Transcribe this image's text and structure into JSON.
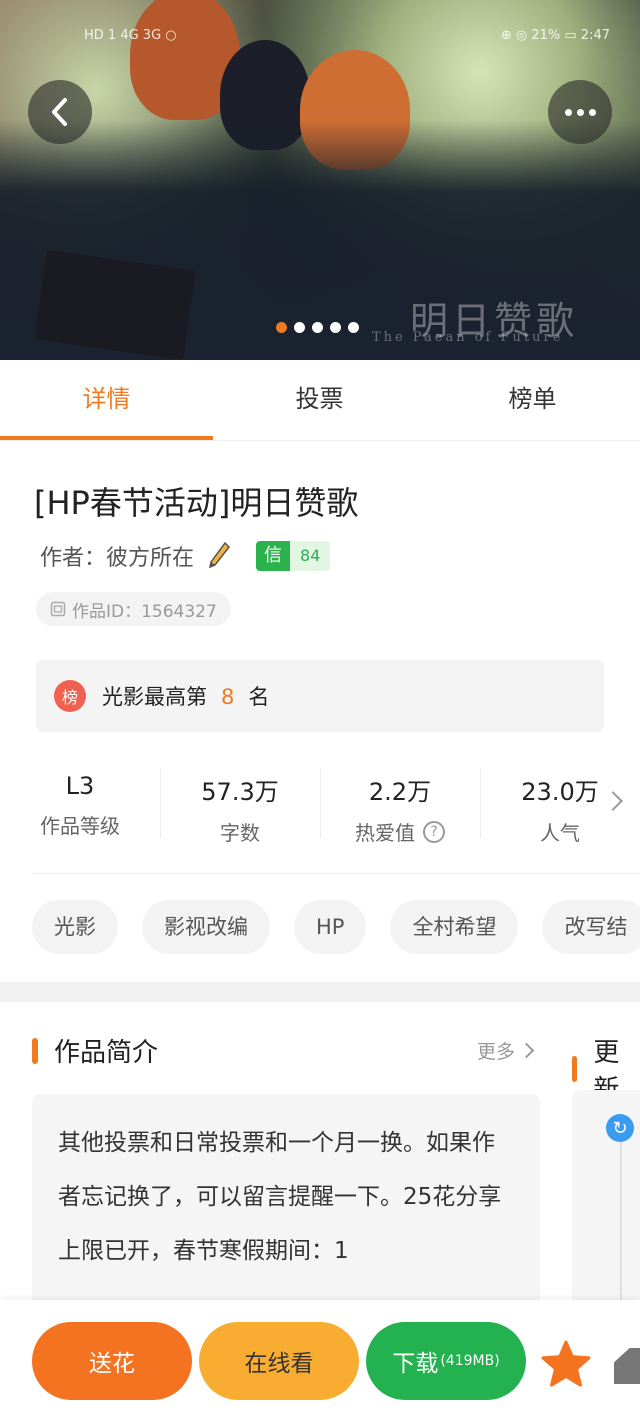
{
  "status_bar": {
    "left": "HD 1 4G 3G ○",
    "right": "⊕ ◎ 21% ▭ 2:47"
  },
  "hero": {
    "art_title": "明日赞歌",
    "art_subtitle": "The Paean of Future",
    "page_count": 5,
    "active_page": 1
  },
  "tabs": [
    {
      "label": "详情"
    },
    {
      "label": "投票"
    },
    {
      "label": "榜单"
    }
  ],
  "work": {
    "title": "[HP春节活动]明日赞歌",
    "author_label": "作者：",
    "author": "彼方所在",
    "credit_key": "信",
    "credit_value": "84",
    "work_id": "作品ID：1564327"
  },
  "rank": {
    "icon": "榜",
    "prefix": "光影最高第",
    "number": "8",
    "suffix": "名"
  },
  "stats": [
    {
      "value": "L3",
      "label": "作品等级"
    },
    {
      "value": "57.3万",
      "label": "字数"
    },
    {
      "value": "2.2万",
      "label": "热爱值"
    },
    {
      "value": "23.0万",
      "label": "人气"
    }
  ],
  "tags": [
    "光影",
    "影视改编",
    "HP",
    "全村希望",
    "改写结"
  ],
  "intro": {
    "title": "作品简介",
    "more": "更多",
    "text": "其他投票和日常投票和一个月一换。如果作者忘记换了，可以留言提醒一下。25花分享上限已开，春节寒假期间：1"
  },
  "update": {
    "title": "更新"
  },
  "bottom": {
    "flower": "送花",
    "online": "在线看",
    "download": "下载",
    "download_size": "(419MB)"
  },
  "colors": {
    "accent": "#ef7a20",
    "green": "#23b24f",
    "yellow": "#f8ad32"
  }
}
